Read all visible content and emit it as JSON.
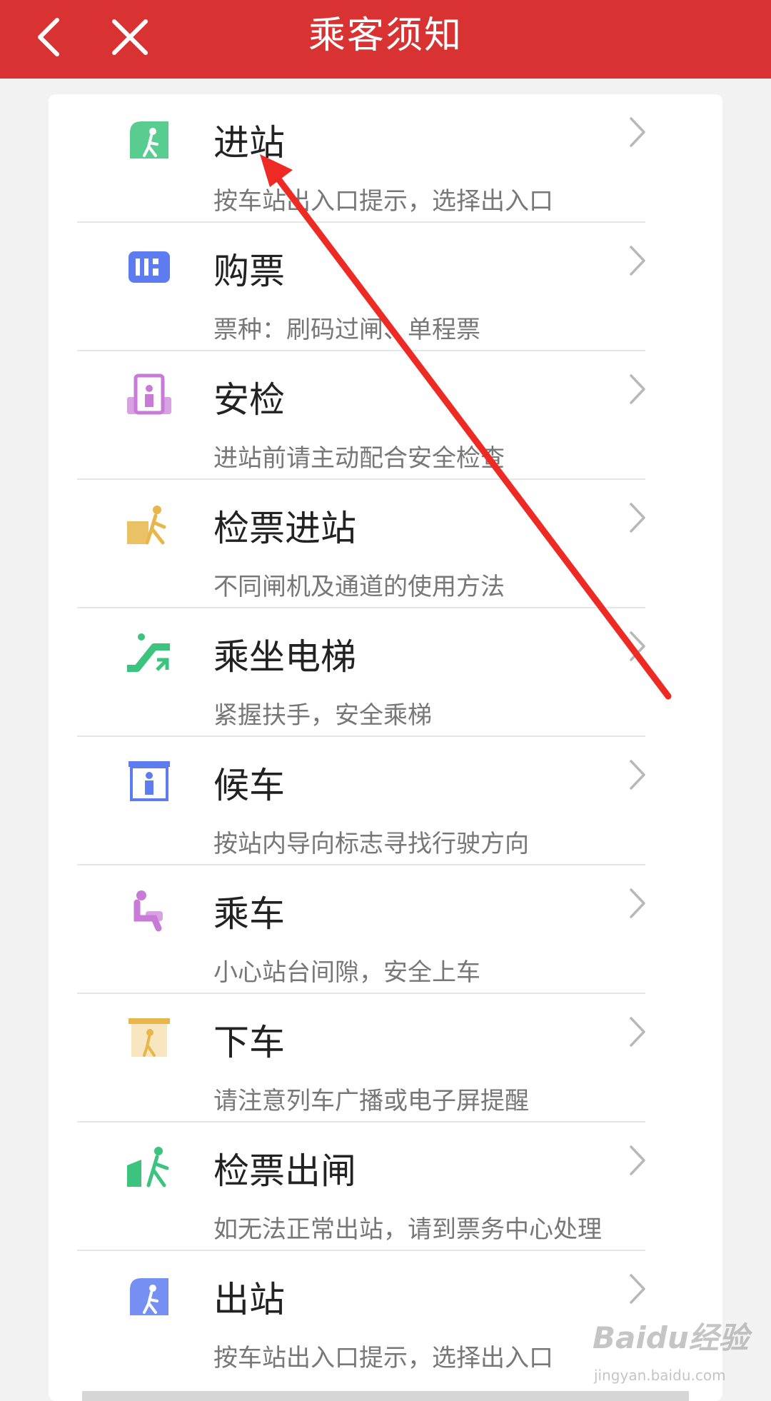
{
  "header": {
    "title": "乘客须知",
    "back_icon": "chevron-left-icon",
    "close_icon": "close-icon",
    "bg_color": "#d93232"
  },
  "items": [
    {
      "label": "进站",
      "desc": "按车站出入口提示，选择出入口",
      "icon": "station-entrance-icon",
      "color": "#3cc37d"
    },
    {
      "label": "购票",
      "desc": "票种：刷码过闸、单程票",
      "icon": "ticket-icon",
      "color": "#5d7cf0"
    },
    {
      "label": "安检",
      "desc": "进站前请主动配合安全检查",
      "icon": "security-check-icon",
      "color": "#c77ad6"
    },
    {
      "label": "检票进站",
      "desc": "不同闸机及通道的使用方法",
      "icon": "ticket-gate-icon",
      "color": "#e8b64a"
    },
    {
      "label": "乘坐电梯",
      "desc": "紧握扶手，安全乘梯",
      "icon": "escalator-icon",
      "color": "#3cc37d"
    },
    {
      "label": "候车",
      "desc": "按站内导向标志寻找行驶方向",
      "icon": "waiting-icon",
      "color": "#5d7cf0"
    },
    {
      "label": "乘车",
      "desc": "小心站台间隙，安全上车",
      "icon": "seat-icon",
      "color": "#c77ad6"
    },
    {
      "label": "下车",
      "desc": "请注意列车广播或电子屏提醒",
      "icon": "exit-train-icon",
      "color": "#e8b64a"
    },
    {
      "label": "检票出闸",
      "desc": "如无法正常出站，请到票务中心处理",
      "icon": "exit-gate-icon",
      "color": "#3cc37d"
    },
    {
      "label": "出站",
      "desc": "按车站出入口提示，选择出入口",
      "icon": "station-exit-icon",
      "color": "#5d7cf0"
    }
  ],
  "annotation": {
    "arrow_color": "#ee2a24"
  },
  "watermark": {
    "main": "Baidu经验",
    "sub": "jingyan.baidu.com"
  }
}
